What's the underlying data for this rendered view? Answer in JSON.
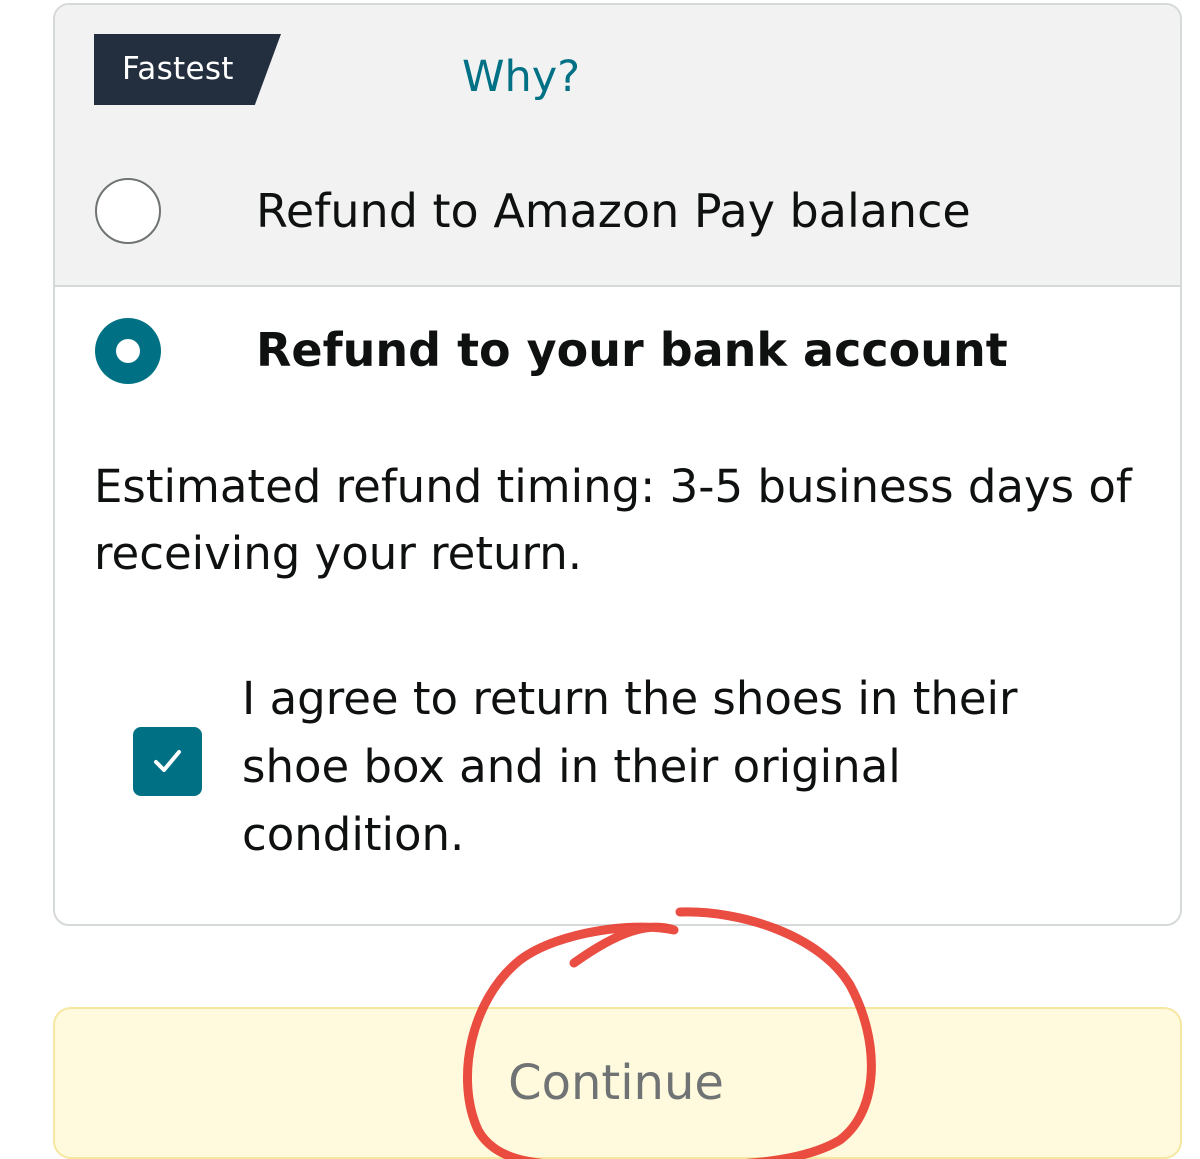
{
  "fastest_option": {
    "badge": "Fastest",
    "why_link": "Why?",
    "label": "Refund to Amazon Pay balance",
    "selected": false
  },
  "bank_option": {
    "label": "Refund to your bank account",
    "selected": true,
    "timing_text": "Estimated refund timing: 3-5 business days of receiving your return."
  },
  "agreement": {
    "checked": true,
    "text": "I agree to return the shoes in their shoe box and in their original condition."
  },
  "continue_button": {
    "label": "Continue"
  },
  "colors": {
    "accent": "#007185",
    "badge_bg": "#232f3e",
    "button_bg": "#fffadd",
    "annotation_red": "#e83a2e"
  },
  "icons": {
    "checkbox": "check-icon"
  }
}
